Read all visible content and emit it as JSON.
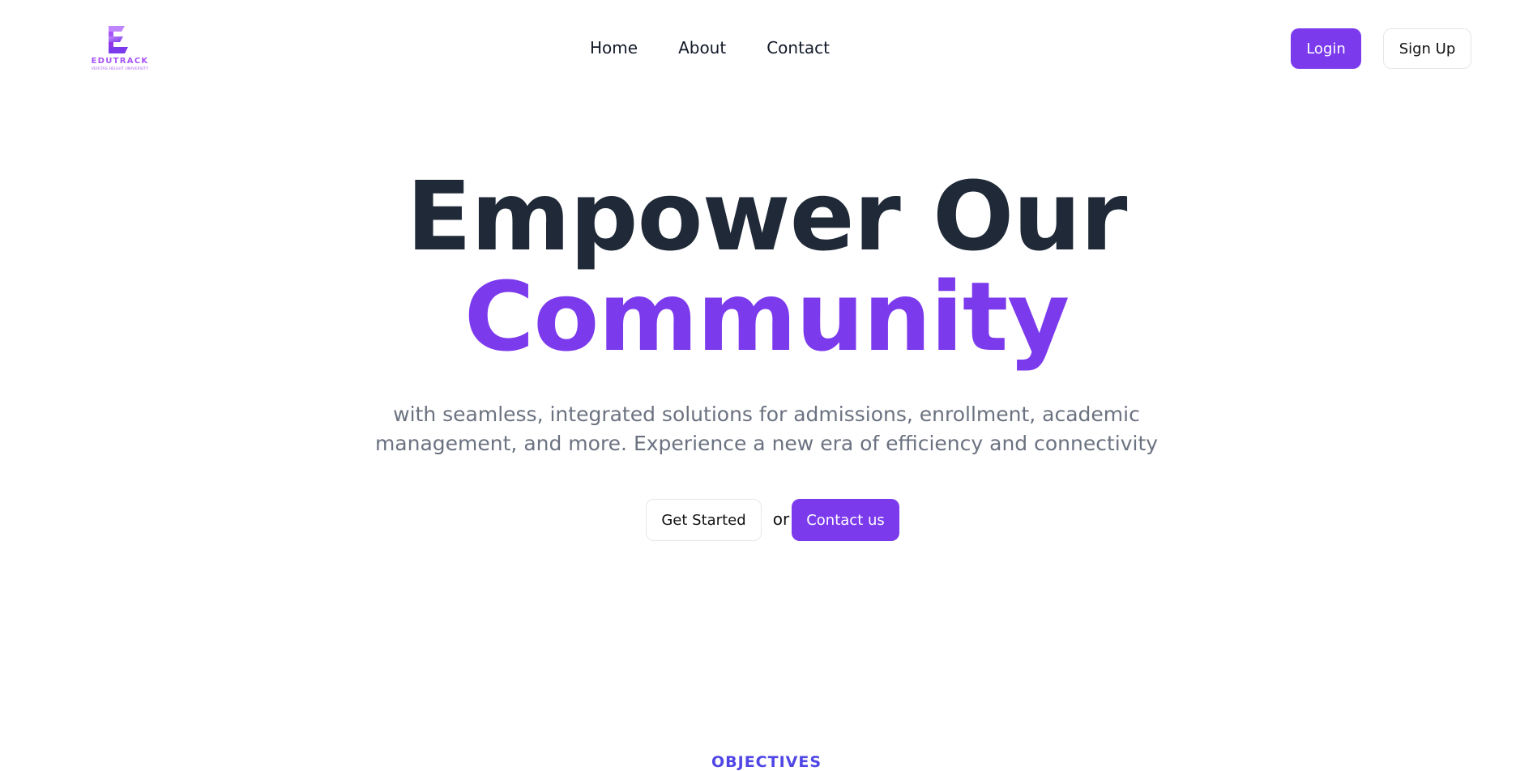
{
  "header": {
    "logo": {
      "name": "EDUTRACK",
      "tagline": "VERITAS HEIGHT UNIVERSITY"
    },
    "nav": [
      {
        "label": "Home"
      },
      {
        "label": "About"
      },
      {
        "label": "Contact"
      }
    ],
    "login_label": "Login",
    "signup_label": "Sign Up"
  },
  "hero": {
    "title_line1": "Empower Our",
    "title_line2": "Community",
    "subtitle": "with seamless, integrated solutions for admissions, enrollment, academic management, and more. Experience a new era of efficiency and connectivity",
    "get_started_label": "Get Started",
    "or_text": "or",
    "contact_label": "Contact us"
  },
  "objectives": {
    "label": "OBJECTIVES"
  },
  "colors": {
    "accent": "#7c3aed",
    "heading": "#1f2937",
    "muted": "#6b7280",
    "section_label": "#4f46e5"
  }
}
